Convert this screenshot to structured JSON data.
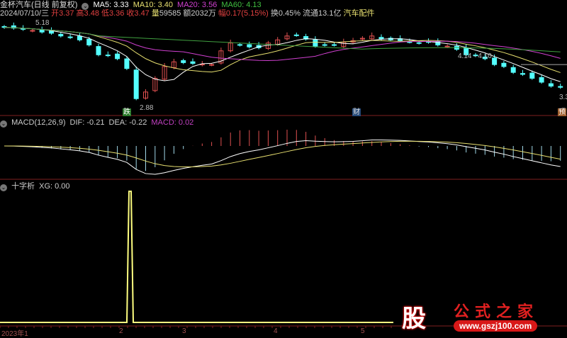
{
  "header": {
    "name": "金杯汽车(日线 前复权)",
    "ma5": "MA5: 3.33",
    "ma10": "MA10: 3.40",
    "ma20": "MA20: 3.56",
    "ma60": "MA60: 4.13",
    "date": "2024/07/10/三",
    "open_l": "开",
    "open": "3.37",
    "high_l": "高",
    "high": "3.48",
    "low_l": "低",
    "low": "3.36",
    "close_l": "收",
    "close": "3.47",
    "vol_l": "量",
    "vol": "59585",
    "amt_l": "额",
    "amt": "2032万",
    "chg_l": "幅",
    "chg": "0.17(5.15%)",
    "turnover": "换0.45%",
    "float": "流通13.1亿",
    "sector": "汽车配件"
  },
  "main": {
    "high_label": "5.18",
    "low_label": "2.88",
    "range_label": "4.14 - 4.10",
    "last_label": "3.3",
    "tag_die": "跌",
    "tag_cai": "财",
    "tag_yu": "预",
    "price_range": [
      2.75,
      5.3
    ],
    "closes": [
      5.0,
      4.98,
      4.95,
      4.92,
      4.88,
      4.85,
      4.78,
      4.74,
      4.68,
      4.55,
      4.3,
      4.28,
      4.2,
      3.95,
      3.18,
      3.35,
      3.7,
      4.0,
      4.12,
      4.1,
      4.08,
      4.06,
      4.05,
      4.4,
      4.6,
      4.55,
      4.5,
      4.48,
      4.6,
      4.68,
      4.78,
      4.8,
      4.7,
      4.52,
      4.55,
      4.55,
      4.62,
      4.66,
      4.72,
      4.78,
      4.7,
      4.68,
      4.66,
      4.63,
      4.6,
      4.62,
      4.55,
      4.52,
      4.44,
      4.3,
      4.28,
      4.2,
      4.05,
      4.0,
      3.85,
      3.8,
      3.7,
      3.6,
      3.5,
      3.47
    ]
  },
  "macd": {
    "title": "MACD(12,26,9)",
    "dif": "DIF: -0.21",
    "dea": "DEA: -0.22",
    "macd": "MACD: 0.02"
  },
  "xg": {
    "title": "十字析",
    "value": "XG: 0.00",
    "spike_index": 14
  },
  "axis": {
    "labels": [
      "2023年1",
      "2",
      "3",
      "4",
      "5"
    ]
  },
  "watermark": {
    "logo": "股",
    "site": "公式之家",
    "url": "www.gszj100.com"
  },
  "colors": {
    "up": "#e05050",
    "down": "#54ffff",
    "ma5": "#ffffff",
    "ma10": "#e8e070",
    "ma20": "#d040d0",
    "ma60": "#40a040",
    "xg": "#ffff80"
  }
}
